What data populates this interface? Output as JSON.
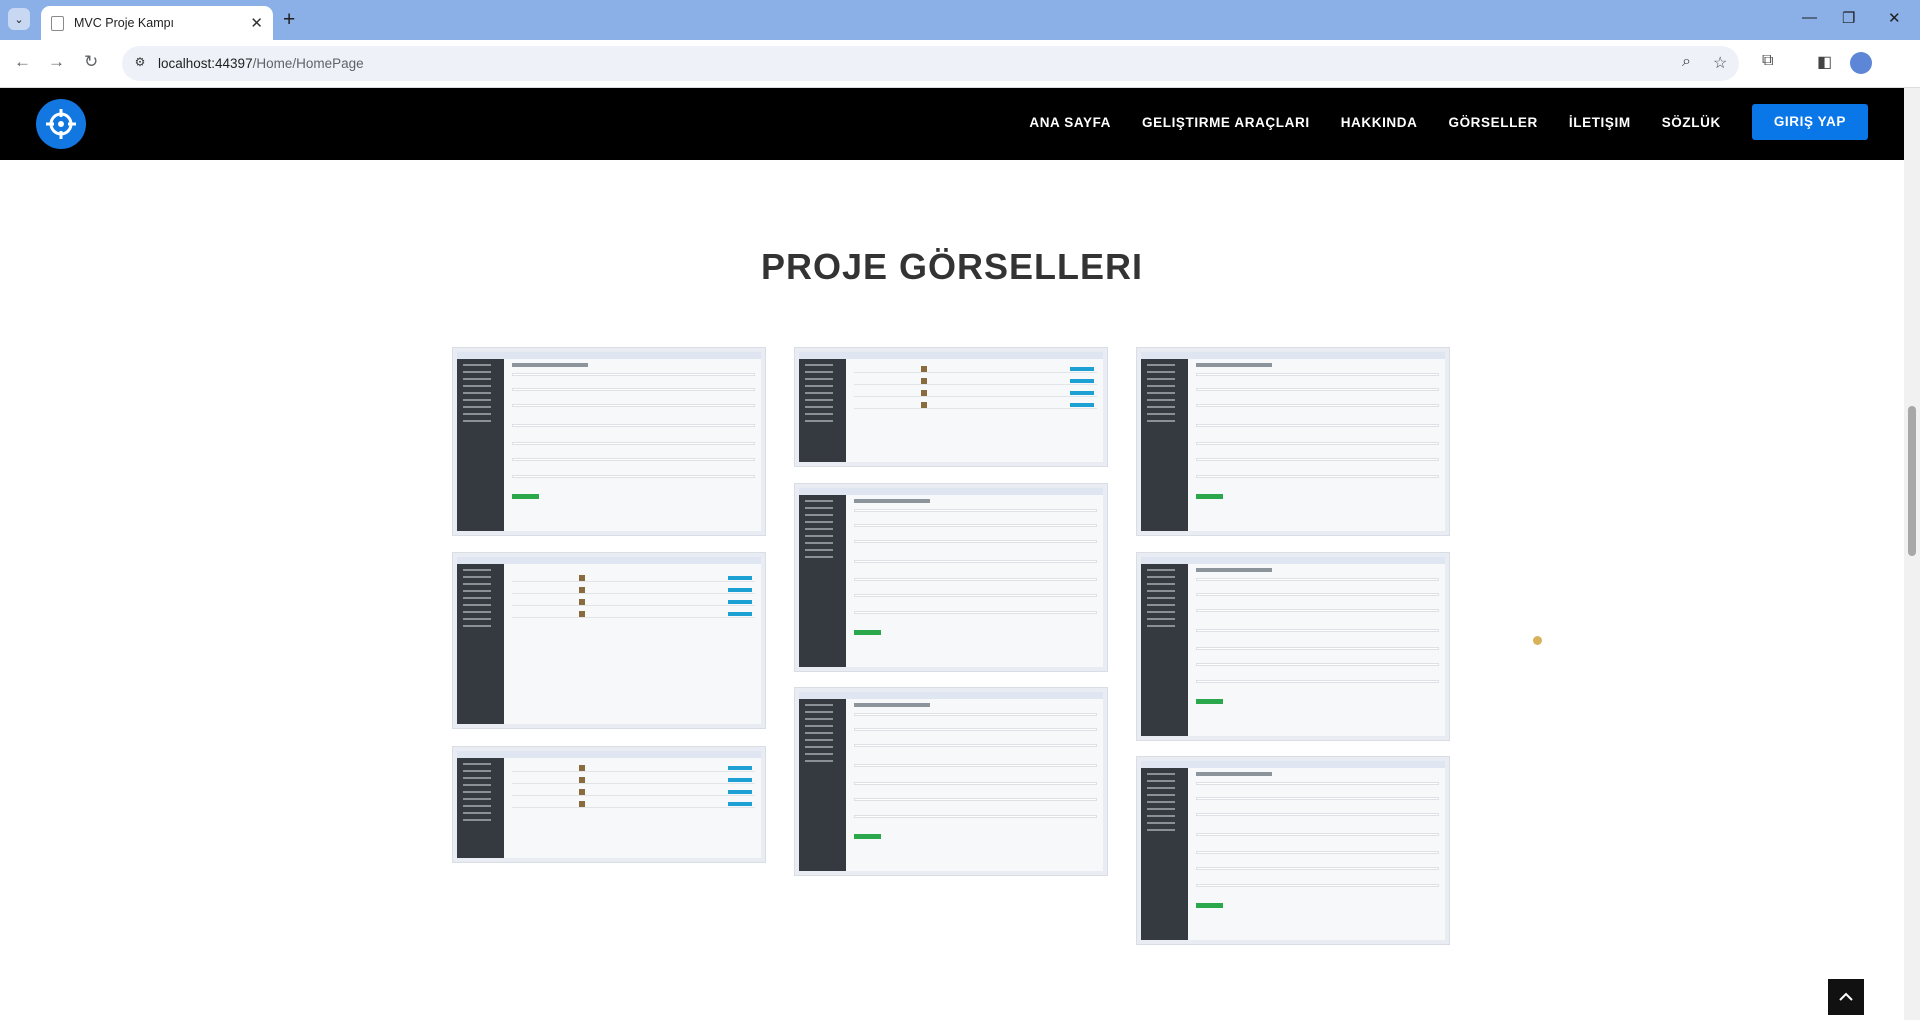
{
  "browser": {
    "tab_title": "MVC Proje Kampı",
    "url_host": "localhost:44397",
    "url_path": "/Home/HomePage"
  },
  "site": {
    "nav": [
      "ANA SAYFA",
      "GELIŞTIRME ARAÇLARI",
      "HAKKINDA",
      "GÖRSELLER",
      "İLETIŞIM",
      "SÖZLÜK"
    ],
    "login_label": "GIRIŞ YAP",
    "section_title": "PROJE GÖRSELLERI"
  },
  "gallery": {
    "items": [
      {
        "kind": "form",
        "label": "Profilinizi Düzenleyin"
      },
      {
        "kind": "list",
        "label": ""
      },
      {
        "kind": "table",
        "label": ""
      },
      {
        "kind": "table",
        "label": ""
      },
      {
        "kind": "form",
        "label": "Profilinizi Düzenleyin"
      },
      {
        "kind": "form",
        "label": "Profilinizi Düzenleyin"
      },
      {
        "kind": "form",
        "label": "Profilinizi Düzenleyin"
      },
      {
        "kind": "form",
        "label": "Profilinizi Düzenleyin"
      },
      {
        "kind": "form",
        "label": "Profilinizi Düzenleyin"
      }
    ]
  },
  "colors": {
    "accent": "#0a77e8",
    "navbar": "#000000",
    "tabbar": "#8ab0e7",
    "sidebar": "#343a40",
    "success": "#2ca84c"
  },
  "icons": [
    "chevron-down-icon",
    "document-icon",
    "close-icon",
    "plus-icon",
    "minimize-icon",
    "restore-icon",
    "back-icon",
    "forward-icon",
    "reload-icon",
    "site-info-icon",
    "zoom-icon",
    "star-icon",
    "extensions-icon",
    "sidepanel-icon",
    "crosshair-logo-icon",
    "arrow-up-icon"
  ]
}
